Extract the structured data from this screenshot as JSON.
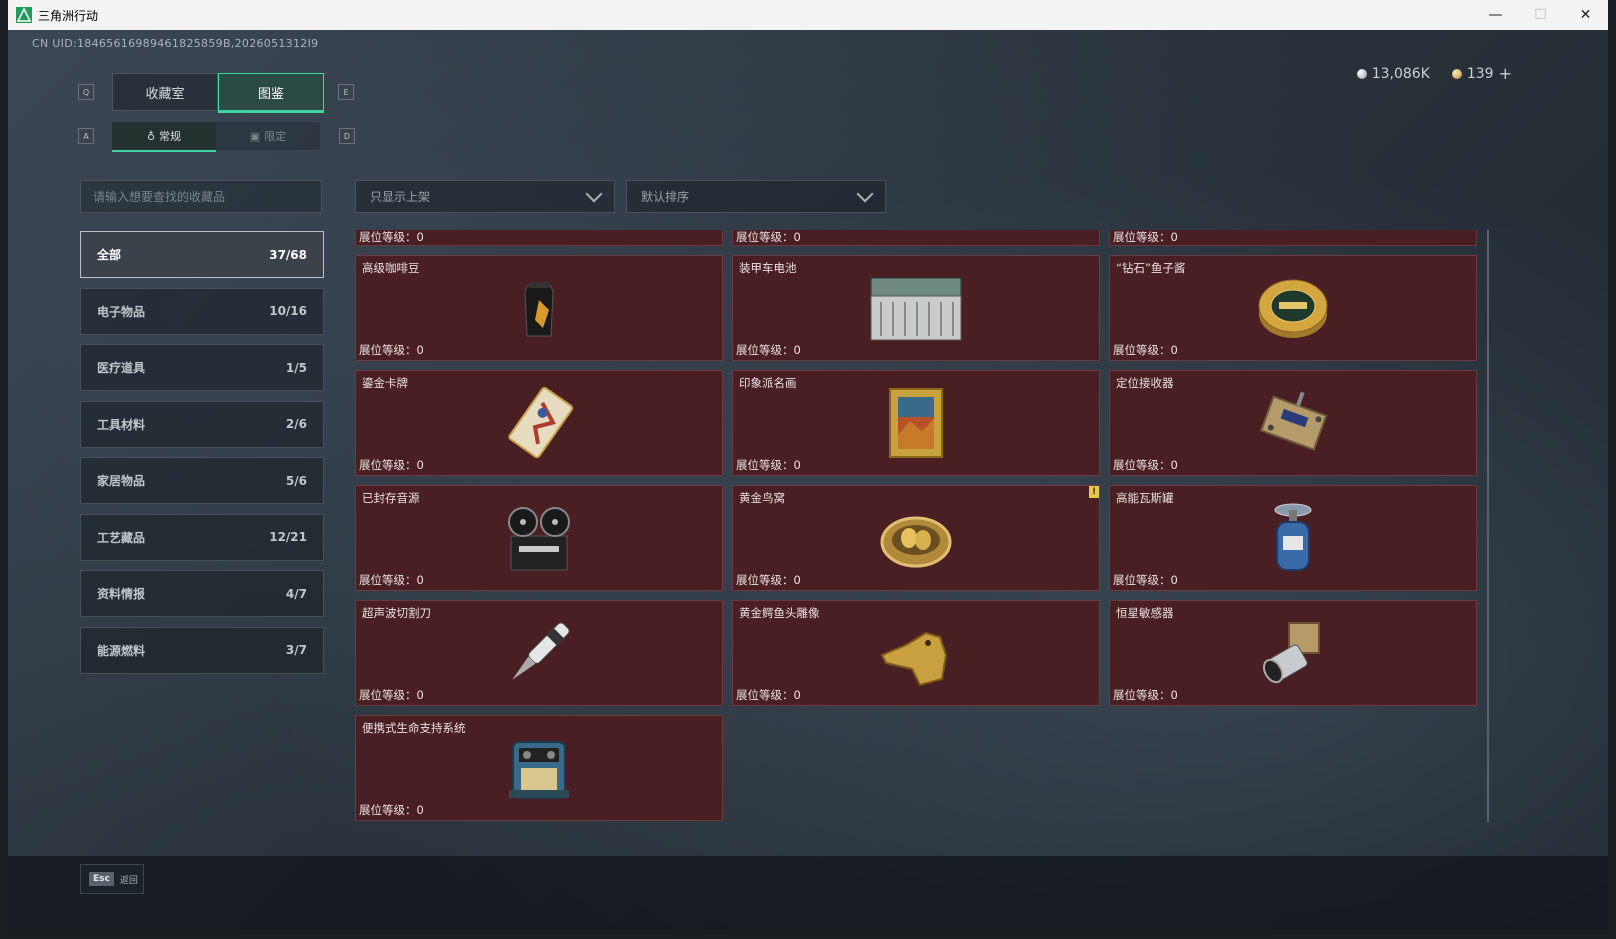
{
  "window": {
    "title": "三角洲行动",
    "controls": [
      "—",
      "☐",
      "✕"
    ]
  },
  "uid": "CN UID:18465616989461825859B,2026051312I9",
  "currency": [
    {
      "icon": "silver-coin-icon",
      "value": "13,086K"
    },
    {
      "icon": "gold-coin-icon",
      "value": "139"
    }
  ],
  "currency_add": "+",
  "keys": {
    "tab_left": "Q",
    "tab_right": "E",
    "sub_left": "A",
    "sub_right": "D"
  },
  "tabs": [
    {
      "label": "收藏室",
      "active": false
    },
    {
      "label": "图鉴",
      "active": true
    }
  ],
  "subtabs": [
    {
      "label": "常规",
      "active": true
    },
    {
      "label": "限定",
      "active": false
    }
  ],
  "search": {
    "placeholder": "请输入想要查找的收藏品"
  },
  "filters": {
    "show": "只显示上架",
    "sort": "默认排序"
  },
  "categories": [
    {
      "label": "全部",
      "count": "37/68",
      "active": true
    },
    {
      "label": "电子物品",
      "count": "10/16"
    },
    {
      "label": "医疗道具",
      "count": "1/5"
    },
    {
      "label": "工具材料",
      "count": "2/6"
    },
    {
      "label": "家居物品",
      "count": "5/6"
    },
    {
      "label": "工艺藏品",
      "count": "12/21"
    },
    {
      "label": "资料情报",
      "count": "4/7"
    },
    {
      "label": "能源燃料",
      "count": "3/7"
    }
  ],
  "level_label": "展位等级：",
  "level_value": "0",
  "items": [
    {
      "name": "高级咖啡豆",
      "icon": "coffee-bag-icon"
    },
    {
      "name": "装甲车电池",
      "icon": "battery-icon"
    },
    {
      "name": "“钻石”鱼子酱",
      "icon": "caviar-tin-icon"
    },
    {
      "name": "鎏金卡牌",
      "icon": "gilded-card-icon"
    },
    {
      "name": "印象派名画",
      "icon": "framed-painting-icon"
    },
    {
      "name": "定位接收器",
      "icon": "receiver-device-icon"
    },
    {
      "name": "已封存音源",
      "icon": "tape-recorder-icon"
    },
    {
      "name": "黄金鸟窝",
      "icon": "golden-nest-icon",
      "warning": true
    },
    {
      "name": "高能瓦斯罐",
      "icon": "gas-canister-icon"
    },
    {
      "name": "超声波切割刀",
      "icon": "ultrasonic-knife-icon"
    },
    {
      "name": "黄金鳄鱼头雕像",
      "icon": "gold-crocodile-icon"
    },
    {
      "name": "恒星敏感器",
      "icon": "star-sensor-icon"
    },
    {
      "name": "便携式生命支持系统",
      "icon": "life-support-icon"
    }
  ],
  "warning_mark": "!",
  "back": {
    "key": "Esc",
    "label": "返回"
  }
}
